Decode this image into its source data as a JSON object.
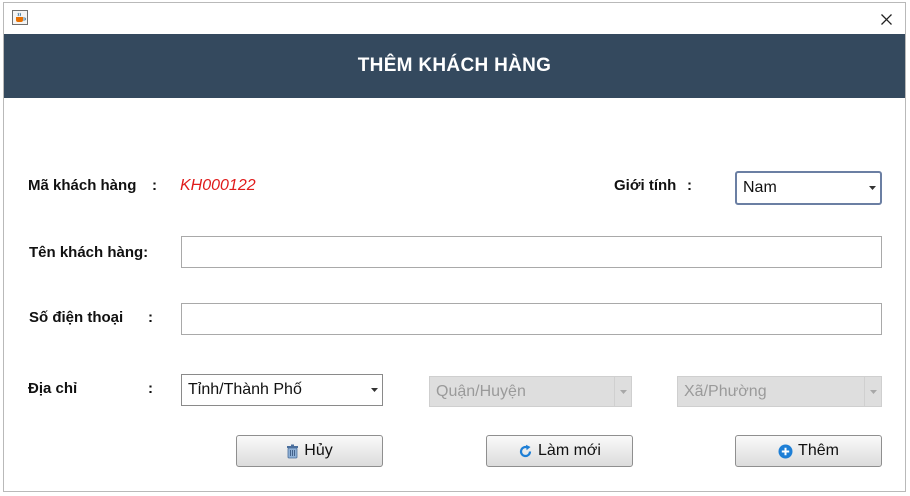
{
  "window": {
    "app_icon": "java-cup-icon",
    "close_symbol": "×"
  },
  "header": {
    "title": "THÊM KHÁCH HÀNG",
    "background": "#34495e"
  },
  "form": {
    "customer_code": {
      "label": "Mã khách hàng",
      "colon": ":",
      "value": "KH000122",
      "value_color": "#e01b1b"
    },
    "gender": {
      "label": "Giới tính",
      "colon": ":",
      "selected": "Nam"
    },
    "name": {
      "label": "Tên khách hàng:",
      "value": ""
    },
    "phone": {
      "label": "Số điện thoại",
      "colon": ":",
      "value": ""
    },
    "address": {
      "label": "Địa chỉ",
      "colon": ":",
      "province": {
        "selected": "Tỉnh/Thành Phố",
        "enabled": true
      },
      "district": {
        "selected": "Quận/Huyện",
        "enabled": false
      },
      "ward": {
        "selected": "Xã/Phường",
        "enabled": false
      }
    }
  },
  "buttons": {
    "cancel": {
      "label": "Hủy",
      "icon": "trash-icon"
    },
    "refresh": {
      "label": "Làm mới",
      "icon": "refresh-icon"
    },
    "add": {
      "label": "Thêm",
      "icon": "plus-circle-icon"
    }
  }
}
